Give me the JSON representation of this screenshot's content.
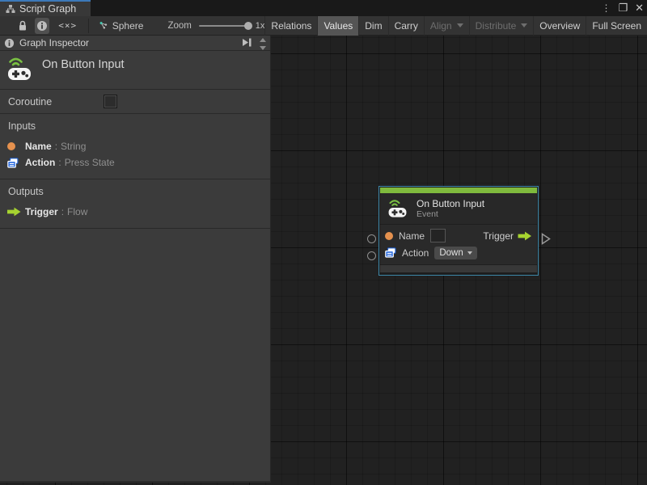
{
  "window": {
    "tab_title": "Script Graph"
  },
  "icons": {
    "kebab": "⋮",
    "maximize": "❐",
    "close": "✕",
    "code": "<×>",
    "info": "i"
  },
  "toolbar": {
    "sphere_label": "Sphere",
    "zoom_label": "Zoom",
    "zoom_value": "1x",
    "buttons": [
      {
        "label": "Relations",
        "state": "normal"
      },
      {
        "label": "Values",
        "state": "active"
      },
      {
        "label": "Dim",
        "state": "normal"
      },
      {
        "label": "Carry",
        "state": "normal"
      },
      {
        "label": "Align",
        "state": "disabled",
        "dropdown": true
      },
      {
        "label": "Distribute",
        "state": "disabled",
        "dropdown": true
      },
      {
        "label": "Overview",
        "state": "normal"
      },
      {
        "label": "Full Screen",
        "state": "normal"
      }
    ]
  },
  "inspector": {
    "header": "Graph Inspector",
    "title": "On Button Input",
    "coroutine_label": "Coroutine",
    "coroutine_checked": false,
    "inputs_header": "Inputs",
    "inputs": [
      {
        "label": "Name",
        "colon": ":",
        "type": "String"
      },
      {
        "label": "Action",
        "colon": ":",
        "type": "Press State"
      }
    ],
    "outputs_header": "Outputs",
    "outputs": [
      {
        "label": "Trigger",
        "colon": ":",
        "type": "Flow"
      }
    ]
  },
  "node": {
    "title": "On Button Input",
    "subtitle": "Event",
    "name_label": "Name",
    "name_value": "",
    "action_label": "Action",
    "action_value": "Down",
    "trigger_label": "Trigger"
  },
  "colors": {
    "accent_green": "#7fba3d",
    "flow_green": "#a6d330",
    "port_orange": "#e5914e",
    "selection_blue": "#3d87a8",
    "tab_accent": "#3c79b9",
    "enum_blue": "#2a6be0"
  }
}
